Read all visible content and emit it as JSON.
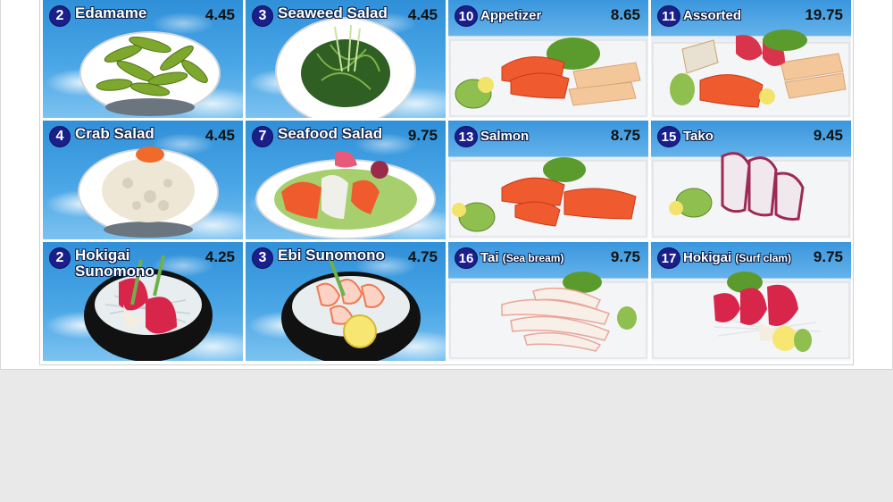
{
  "items": [
    {
      "num": "2",
      "name": "Edamame",
      "price": "4.45"
    },
    {
      "num": "3",
      "name": "Seaweed Salad",
      "price": "4.45"
    },
    {
      "num": "10",
      "name": "Appetizer",
      "price": "8.65"
    },
    {
      "num": "11",
      "name": "Assorted",
      "price": "19.75"
    },
    {
      "num": "4",
      "name": "Crab Salad",
      "price": "4.45"
    },
    {
      "num": "7",
      "name": "Seafood Salad",
      "price": "9.75"
    },
    {
      "num": "13",
      "name": "Salmon",
      "price": "8.75"
    },
    {
      "num": "15",
      "name": "Tako",
      "price": "9.45"
    },
    {
      "num": "2",
      "name_line1": "Hokigai",
      "name_line2": "Sunomono",
      "price": "4.25"
    },
    {
      "num": "3",
      "name": "Ebi Sunomono",
      "price": "4.75"
    },
    {
      "num": "16",
      "name": "Tai",
      "sub": "(Sea bream)",
      "price": "9.75"
    },
    {
      "num": "17",
      "name": "Hokigai",
      "sub": "(Surf clam)",
      "price": "9.75"
    }
  ],
  "colors": {
    "badge": "#1a1f8c",
    "sky": "#3a96dd",
    "price": "#111111"
  },
  "icons": [
    "edamame-bowl-image",
    "seaweed-bowl-image",
    "sashimi-plate-image",
    "crab-salad-image",
    "seafood-salad-image",
    "salmon-plate-image",
    "tako-plate-image",
    "sunomono-bowl-image",
    "ebi-bowl-image",
    "tai-plate-image",
    "hokigai-plate-image"
  ]
}
